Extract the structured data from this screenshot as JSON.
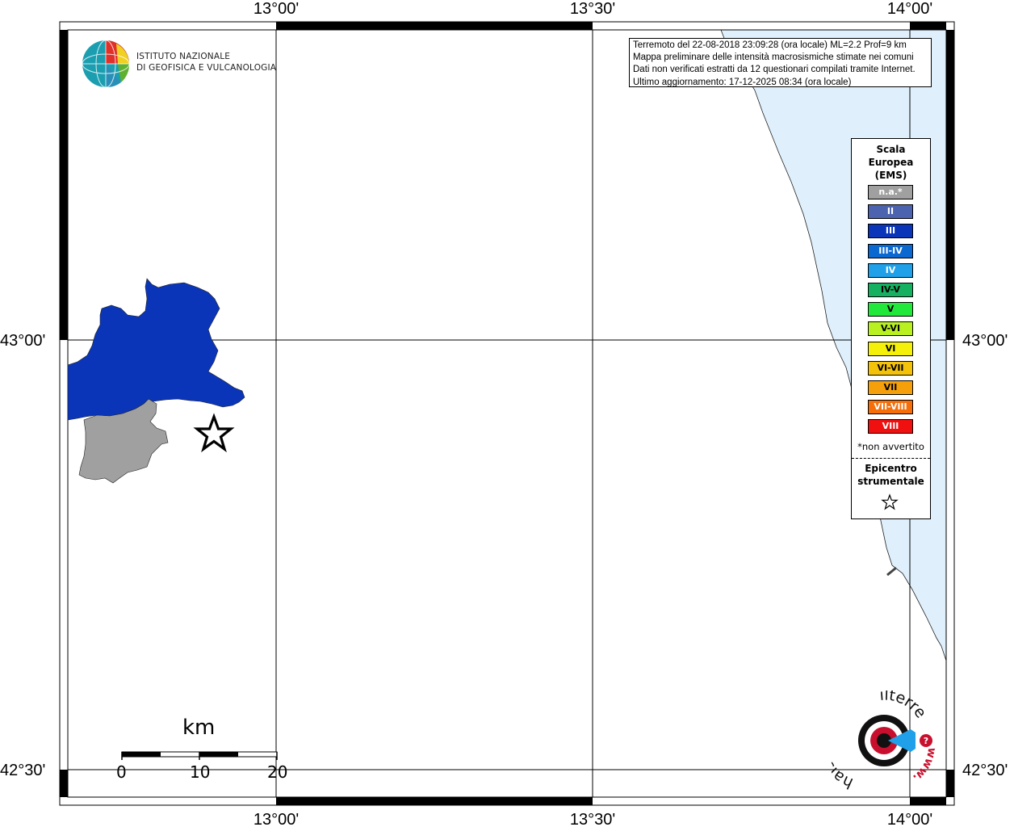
{
  "header": {
    "lon_labels_top": [
      "13°00'",
      "13°30'",
      "14°00'"
    ],
    "lon_labels_bottom": [
      "13°00'",
      "13°30'",
      "14°00'"
    ],
    "lat_labels_left": [
      "43°00'",
      "42°30'"
    ],
    "lat_labels_right": [
      "43°00'",
      "42°30'"
    ]
  },
  "info": {
    "line1": "Terremoto del 22-08-2018 23:09:28 (ora locale) ML=2.2 Prof=9 km",
    "line2": "Mappa preliminare delle intensità macrosismiche stimate nei comuni",
    "line3": "Dati non verificati estratti da 12 questionari compilati tramite Internet.",
    "line4": "Ultimo aggiornamento: 17-12-2025 08:34 (ora locale)"
  },
  "logo": {
    "line1": "ISTITUTO NAZIONALE",
    "line2": "DI GEOFISICA E VULCANOLOGIA"
  },
  "legend": {
    "title1": "Scala",
    "title2": "Europea",
    "title3": "(EMS)",
    "items": [
      {
        "label": "n.a.*",
        "color": "#a0a0a0"
      },
      {
        "label": "II",
        "color": "#4c63b0"
      },
      {
        "label": "III",
        "color": "#0a35b8"
      },
      {
        "label": "III-IV",
        "color": "#0a68d0"
      },
      {
        "label": "IV",
        "color": "#1fa0e8"
      },
      {
        "label": "IV-V",
        "color": "#15b060"
      },
      {
        "label": "V",
        "color": "#22e83c"
      },
      {
        "label": "V-VI",
        "color": "#b8f020"
      },
      {
        "label": "VI",
        "color": "#f5f00a"
      },
      {
        "label": "VI-VII",
        "color": "#f5c20a"
      },
      {
        "label": "VII",
        "color": "#f5a00a"
      },
      {
        "label": "VII-VIII",
        "color": "#f56e0a"
      },
      {
        "label": "VIII",
        "color": "#f01010"
      }
    ],
    "note": "*non avvertito",
    "epicenter1": "Epicentro",
    "epicenter2": "strumentale"
  },
  "scale": {
    "unit": "km",
    "ticks": [
      "0",
      "10",
      "20"
    ]
  },
  "regions": {
    "area_iii_color": "#0a35b8",
    "area_na_color": "#a0a0a0",
    "sea_color": "#dff0fc"
  },
  "badge": {
    "text_left": "haisentito",
    "text_right": "ilterremoto.it",
    "text_www": "www."
  }
}
